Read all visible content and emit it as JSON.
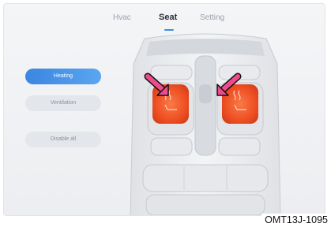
{
  "tabs": [
    {
      "label": "Hvac",
      "active": false
    },
    {
      "label": "Seat",
      "active": true
    },
    {
      "label": "Setting",
      "active": false
    }
  ],
  "side_buttons": {
    "heating": "Heating",
    "ventilation": "Ventilation",
    "disable_all": "Disable all"
  },
  "figure_code": "OMT13J-1095",
  "colors": {
    "accent_blue": "#3d8ee6",
    "heat_orange": "#f0572a",
    "arrow_pink": "#ee4b8c",
    "tab_underline": "#3d8ee6"
  },
  "icons": [
    "seat-heat-icon-left",
    "seat-heat-icon-right",
    "arrow-left",
    "arrow-right"
  ]
}
